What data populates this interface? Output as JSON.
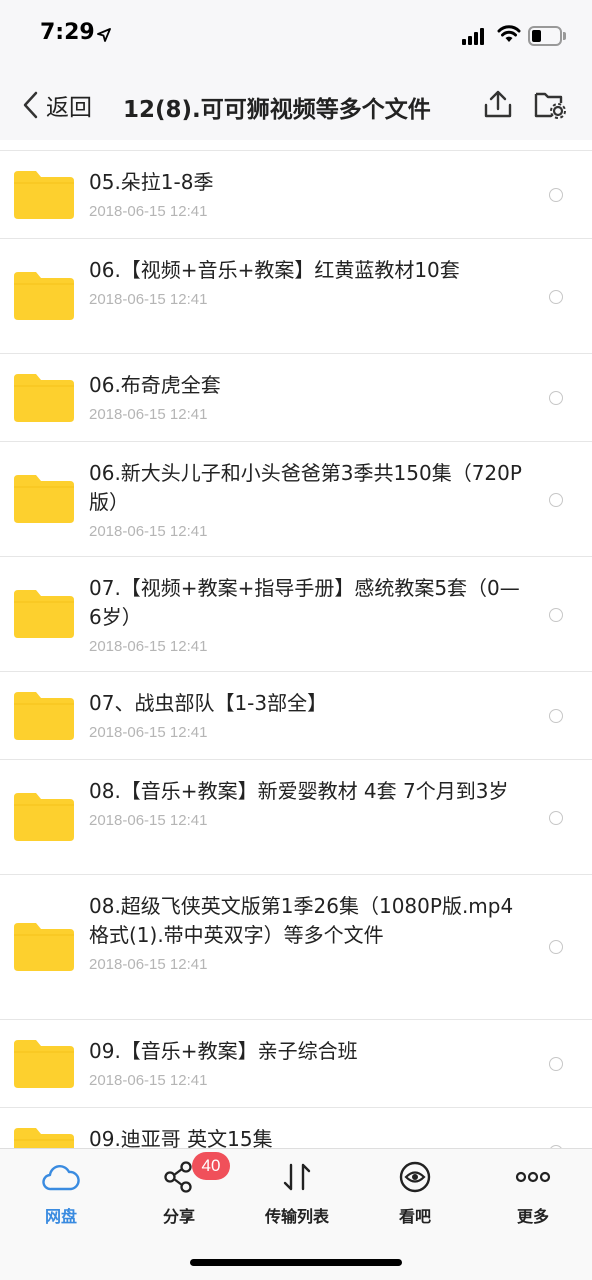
{
  "status_bar": {
    "time": "7:29"
  },
  "nav": {
    "back_label": "返回",
    "title": "12(8).可可狮视频等多个文件"
  },
  "files": [
    {
      "name": "05.朵拉1-8季",
      "date": "2018-06-15 12:41"
    },
    {
      "name": "06.【视频+音乐+教案】红黄蓝教材10套",
      "date": "2018-06-15 12:41"
    },
    {
      "name": "06.布奇虎全套",
      "date": "2018-06-15 12:41"
    },
    {
      "name": "06.新大头儿子和小头爸爸第3季共150集（720P版）",
      "date": "2018-06-15 12:41"
    },
    {
      "name": "07.【视频+教案+指导手册】感统教案5套（0—6岁）",
      "date": "2018-06-15 12:41"
    },
    {
      "name": "07、战虫部队【1-3部全】",
      "date": "2018-06-15 12:41"
    },
    {
      "name": "08.【音乐+教案】新爱婴教材 4套  7个月到3岁",
      "date": "2018-06-15 12:41"
    },
    {
      "name": "08.超级飞侠英文版第1季26集（1080P版.mp4格式(1).带中英双字）等多个文件",
      "date": "2018-06-15 12:41"
    },
    {
      "name": "09.【音乐+教案】亲子综合班",
      "date": "2018-06-15 12:41"
    },
    {
      "name": "09.迪亚哥 英文15集",
      "date": ""
    }
  ],
  "tabs": [
    {
      "label": "网盘",
      "icon": "cloud-icon",
      "active": true
    },
    {
      "label": "分享",
      "icon": "share-icon",
      "badge": "40"
    },
    {
      "label": "传输列表",
      "icon": "transfer-icon"
    },
    {
      "label": "看吧",
      "icon": "eye-icon"
    },
    {
      "label": "更多",
      "icon": "more-icon"
    }
  ],
  "colors": {
    "accent": "#3a8be0",
    "folder": "#fdd02e",
    "badge": "#f0505a"
  }
}
